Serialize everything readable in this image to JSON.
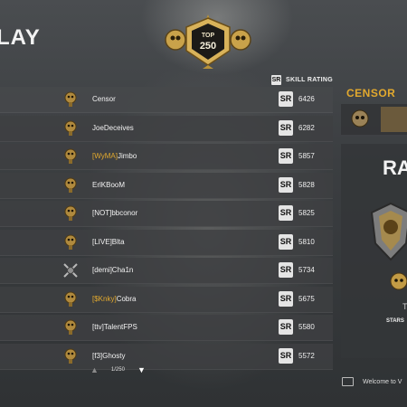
{
  "title": "LAY",
  "emblem": {
    "top_label": "TOP",
    "top_number": "250"
  },
  "header": {
    "sr_icon": "SR",
    "skill_label": "SKILL RATING"
  },
  "rows": [
    {
      "clan": "",
      "name": "Censor",
      "rating": "6426",
      "icon": "skull-trophy-icon"
    },
    {
      "clan": "",
      "name": "JoeDeceives",
      "rating": "6282",
      "icon": "skull-trophy-icon"
    },
    {
      "clan": "[WyMA]",
      "name": "Jimbo",
      "rating": "5857",
      "icon": "skull-trophy-icon"
    },
    {
      "clan": "",
      "name": "ErlKBooM",
      "rating": "5828",
      "icon": "skull-trophy-icon"
    },
    {
      "clan": "",
      "name": "[NOT]bbconor",
      "rating": "5825",
      "icon": "skull-trophy-icon"
    },
    {
      "clan": "",
      "name": "[LIVE]Blta",
      "rating": "5810",
      "icon": "skull-trophy-icon"
    },
    {
      "clan": "",
      "name": "[demi]Cha1n",
      "rating": "5734",
      "icon": "crossed-swords-icon"
    },
    {
      "clan": "[$Knky]",
      "name": "Cobra",
      "rating": "5675",
      "icon": "skull-trophy-icon"
    },
    {
      "clan": "",
      "name": "[ttv]TalentFPS",
      "rating": "5580",
      "icon": "skull-trophy-icon"
    },
    {
      "clan": "",
      "name": "[f3]Ghosty",
      "rating": "5572",
      "icon": "skull-trophy-icon"
    }
  ],
  "pager": {
    "page": "1/250"
  },
  "side": {
    "name": "CENSOR",
    "rank": "RA",
    "t_letter": "T",
    "stars": "STARS"
  },
  "footer": {
    "text": "Welcome to V"
  },
  "colors": {
    "accent": "#e2a92e",
    "row_bg": "#3e4042",
    "badge": "#e4e4e4"
  }
}
